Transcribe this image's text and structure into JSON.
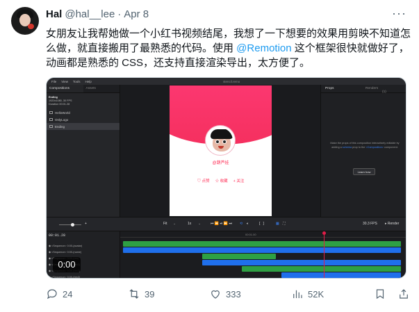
{
  "tweet": {
    "name": "Hal",
    "handle": "@hal__lee",
    "dot": "·",
    "date": "Apr 8",
    "text_before": "女朋友让我帮她做一个小红书视频结尾，我想了一下想要的效果用剪映不知道怎么做，就直接搬用了最熟悉的代码。使用 ",
    "mention": "@Remotion",
    "text_after": " 这个框架很快就做好了，动画都是熟悉的 CSS，还支持直接渲染导出，太方便了。"
  },
  "media": {
    "menu": [
      "File",
      "View",
      "Tools",
      "Help"
    ],
    "window_title": "stencil.remo",
    "left_tabs": [
      "Compositions",
      "Assets"
    ],
    "comp_info": {
      "name": "Ending",
      "line1": "1920x1080, 30 FPS",
      "line2": "Duration 00:01.28"
    },
    "compositions": [
      {
        "label": "HelloWorld",
        "selected": false
      },
      {
        "label": "OnlyLogo",
        "selected": false
      },
      {
        "label": "Ending",
        "selected": true
      }
    ],
    "phone": {
      "name": "@葫芦娃",
      "actions": [
        "♡ 点赞",
        "☆ 收藏",
        "+ 关注"
      ]
    },
    "right_tabs": [
      "Props",
      "Renders"
    ],
    "right_tab_count": "(1)",
    "props_desc_1": "Make the props of this composition interactively editable by adding a ",
    "props_desc_link": "schema",
    "props_desc_2": " prop to the ",
    "props_desc_comp": "<Composition>",
    "props_desc_3": " component.",
    "learn_btn": "Learn how",
    "controls": {
      "fit": "Fit",
      "speed": "1x",
      "fps": "30.3 FPS",
      "render": "Render",
      "plus": "+"
    },
    "timeline": {
      "time": "00:01.28",
      "ruler_label": "00:01.00",
      "rows": [
        "◆ <Sequence> 0:00-(avatar)",
        "◆ <Sequence> 0:00-(name)",
        "◆ <Sequence> 0:00-(btn)",
        "◆ <Sequence> 0:00-(btn2)",
        "◆ <Sequence> 0:00-(btn3)",
        "◆ <Sequence> 0:00-(btn3)"
      ]
    }
  },
  "video_time": "0:00",
  "actions": {
    "replies": "24",
    "retweets": "39",
    "likes": "333",
    "views": "52K"
  },
  "colors": {
    "accent": "#1d9bf0",
    "muted": "#536471",
    "pink": "#ff2d55"
  }
}
